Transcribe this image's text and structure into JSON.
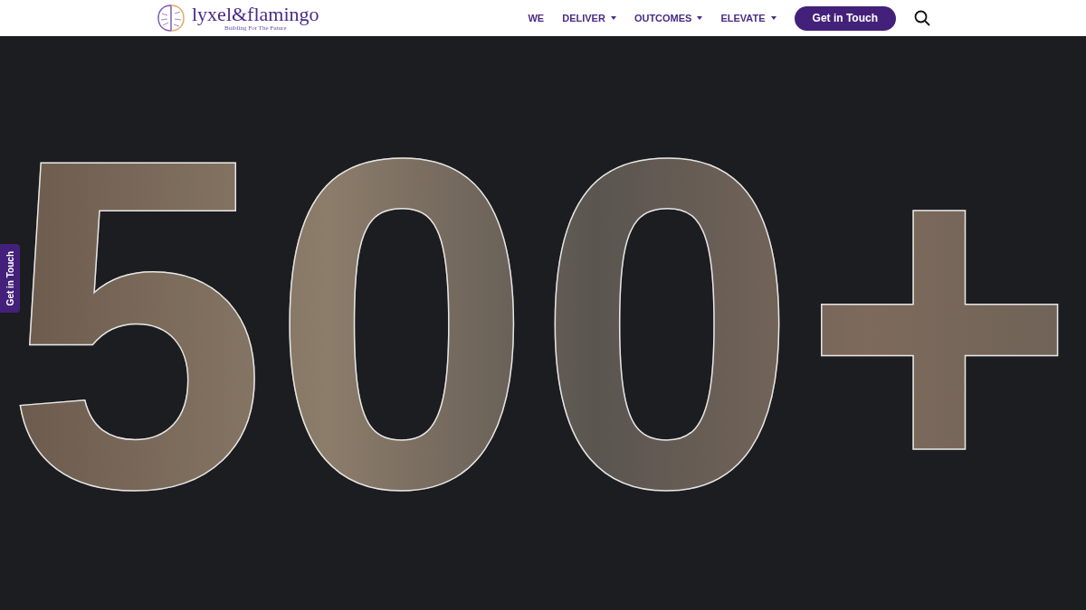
{
  "header": {
    "logo": {
      "name": "lyxel&flamingo",
      "tagline": "Building For The Future"
    },
    "nav": [
      {
        "label": "WE",
        "dropdown": false
      },
      {
        "label": "DELIVER",
        "dropdown": true
      },
      {
        "label": "OUTCOMES",
        "dropdown": true
      },
      {
        "label": "ELEVATE",
        "dropdown": true
      }
    ],
    "cta": "Get in Touch"
  },
  "hero": {
    "number": "500+"
  },
  "side_tab": "Get in Touch"
}
